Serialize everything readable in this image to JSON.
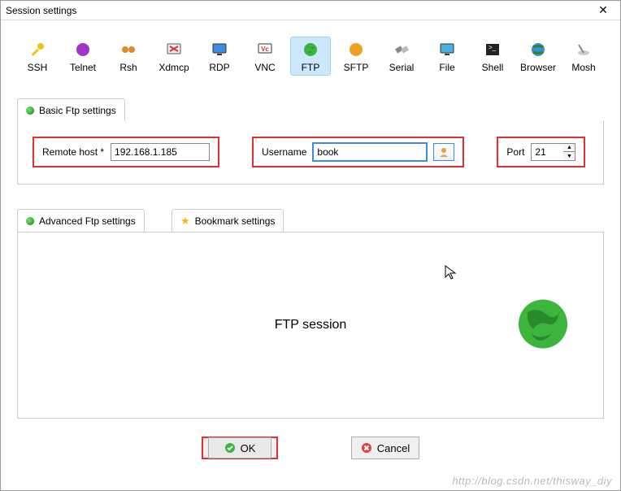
{
  "window": {
    "title": "Session settings"
  },
  "protocols": [
    {
      "id": "ssh",
      "label": "SSH"
    },
    {
      "id": "telnet",
      "label": "Telnet"
    },
    {
      "id": "rsh",
      "label": "Rsh"
    },
    {
      "id": "xdmcp",
      "label": "Xdmcp"
    },
    {
      "id": "rdp",
      "label": "RDP"
    },
    {
      "id": "vnc",
      "label": "VNC"
    },
    {
      "id": "ftp",
      "label": "FTP",
      "selected": true
    },
    {
      "id": "sftp",
      "label": "SFTP"
    },
    {
      "id": "serial",
      "label": "Serial"
    },
    {
      "id": "file",
      "label": "File"
    },
    {
      "id": "shell",
      "label": "Shell"
    },
    {
      "id": "browser",
      "label": "Browser"
    },
    {
      "id": "mosh",
      "label": "Mosh"
    }
  ],
  "basicTab": {
    "label": "Basic Ftp settings"
  },
  "fields": {
    "remote_host_label": "Remote host *",
    "remote_host_value": "192.168.1.185",
    "username_label": "Username",
    "username_value": "book",
    "port_label": "Port",
    "port_value": "21"
  },
  "lowerTabs": {
    "advanced": "Advanced Ftp settings",
    "bookmark": "Bookmark settings"
  },
  "session": {
    "label": "FTP session"
  },
  "buttons": {
    "ok": "OK",
    "cancel": "Cancel"
  },
  "watermark": "http://blog.csdn.net/thisway_diy"
}
